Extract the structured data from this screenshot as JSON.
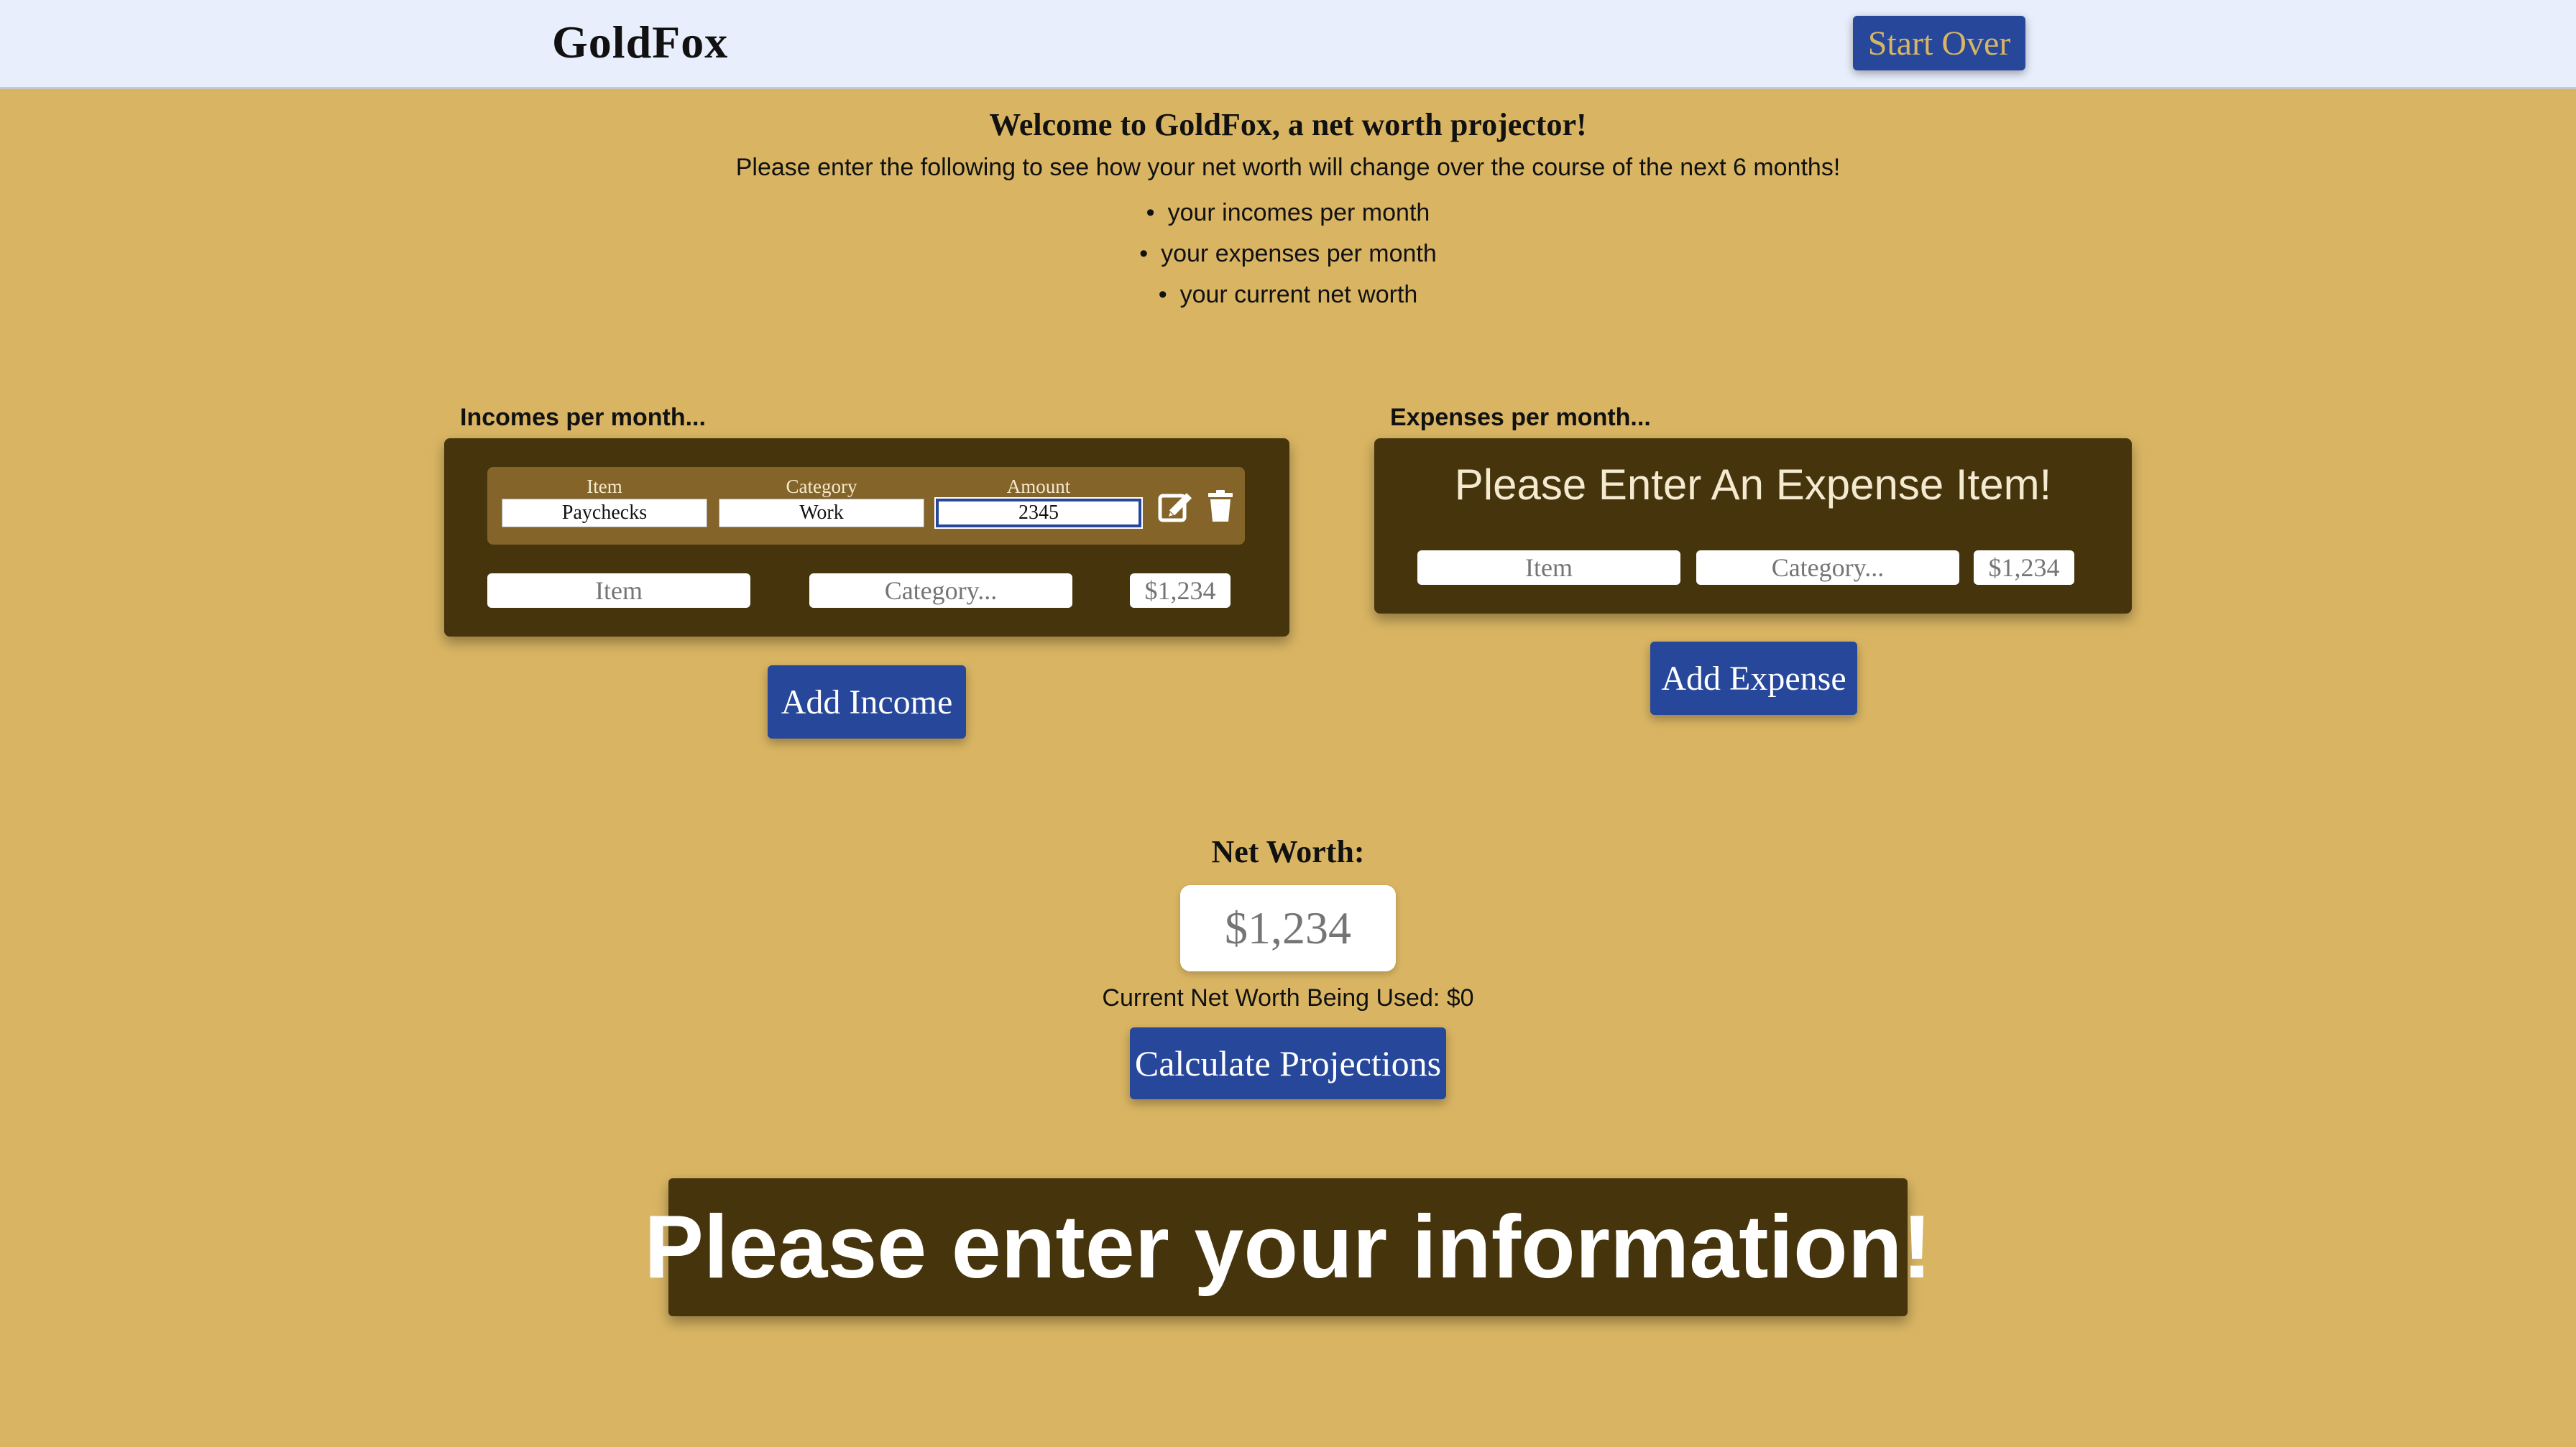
{
  "header": {
    "brand": "GoldFox",
    "start_over_label": "Start Over"
  },
  "intro": {
    "welcome": "Welcome to GoldFox, a net worth projector!",
    "instructions": "Please enter the following to see how your net worth will change over the course of the next 6 months!",
    "bullets": [
      "your incomes per month",
      "your expenses per month",
      "your current net worth"
    ]
  },
  "incomes": {
    "section_label": "Incomes per month...",
    "columns": [
      "Item",
      "Category",
      "Amount"
    ],
    "rows": [
      {
        "item": "Paychecks",
        "category": "Work",
        "amount": "2345"
      }
    ],
    "new_entry": {
      "item_placeholder": "Item",
      "category_placeholder": "Category...",
      "amount_placeholder": "$1,234"
    },
    "add_label": "Add Income",
    "icons": [
      "edit-icon",
      "trash-icon"
    ]
  },
  "expenses": {
    "section_label": "Expenses per month...",
    "empty_message": "Please Enter An Expense Item!",
    "new_entry": {
      "item_placeholder": "Item",
      "category_placeholder": "Category...",
      "amount_placeholder": "$1,234"
    },
    "add_label": "Add Expense"
  },
  "networth": {
    "label": "Net Worth:",
    "placeholder": "$1,234",
    "current_text": "Current Net Worth Being Used: $0",
    "calculate_label": "Calculate Projections"
  },
  "banner": {
    "message": "Please enter your information!"
  },
  "colors": {
    "background": "#d9b563",
    "header_bg": "#e8eefc",
    "panel": "#46350c",
    "row_bg": "#846428",
    "button_blue": "#26479a"
  }
}
